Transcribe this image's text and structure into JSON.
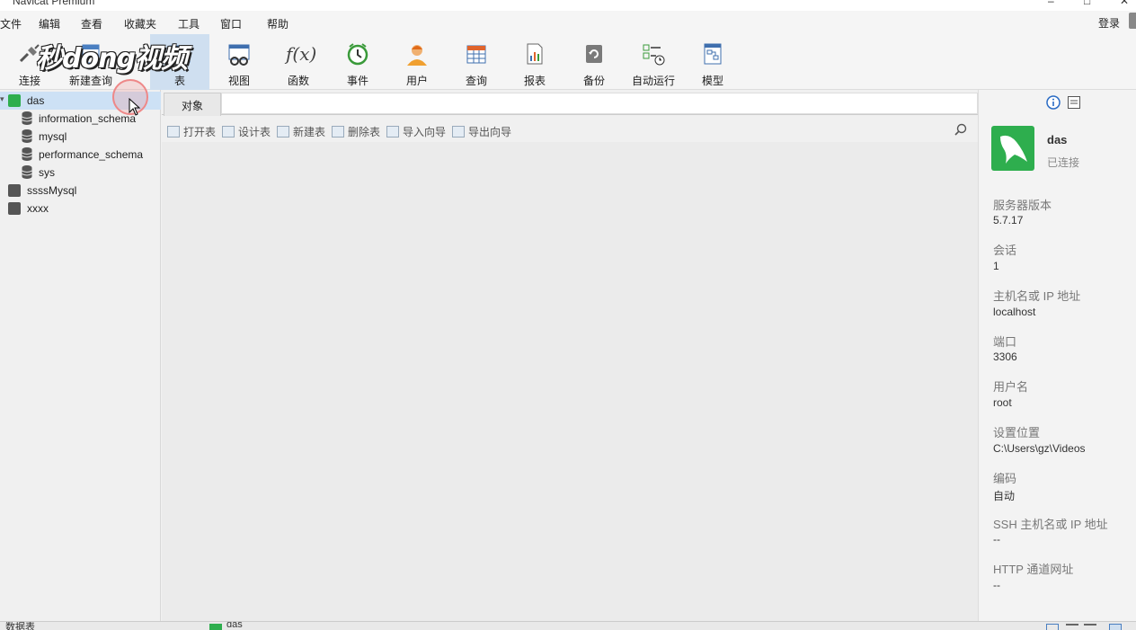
{
  "window": {
    "title": "Navicat Premium",
    "controls": [
      "–",
      "□",
      "✕"
    ]
  },
  "menu": [
    "文件",
    "编辑",
    "查看",
    "收藏夹",
    "工具",
    "窗口",
    "帮助"
  ],
  "login_label": "登录",
  "toolbar": {
    "items": [
      {
        "label": "连接",
        "icon": "connection-icon"
      },
      {
        "label": "新建查询",
        "icon": "new-query-icon"
      },
      {
        "label": "表",
        "icon": "table-icon",
        "active": true
      },
      {
        "label": "视图",
        "icon": "view-icon"
      },
      {
        "label": "函数",
        "icon": "function-icon",
        "glyph": "f(x)"
      },
      {
        "label": "事件",
        "icon": "event-clock-icon"
      },
      {
        "label": "用户",
        "icon": "user-icon"
      },
      {
        "label": "查询",
        "icon": "query-icon"
      },
      {
        "label": "报表",
        "icon": "report-icon"
      },
      {
        "label": "备份",
        "icon": "backup-icon"
      },
      {
        "label": "自动运行",
        "icon": "automation-icon"
      },
      {
        "label": "模型",
        "icon": "model-icon"
      }
    ]
  },
  "watermark": "秒dong视频",
  "tree": {
    "connections": [
      {
        "name": "das",
        "expanded": true,
        "selected": true,
        "databases": [
          "information_schema",
          "mysql",
          "performance_schema",
          "sys"
        ]
      },
      {
        "name": "ssssMysql"
      },
      {
        "name": "xxxx"
      }
    ]
  },
  "tabs": {
    "objects": "对象"
  },
  "object_toolbar": [
    "打开表",
    "设计表",
    "新建表",
    "删除表",
    "导入向导",
    "导出向导"
  ],
  "info_panel": {
    "name": "das",
    "status": "已连接",
    "fields": [
      {
        "label": "服务器版本",
        "value": "5.7.17"
      },
      {
        "label": "会话",
        "value": "1"
      },
      {
        "label": "主机名或 IP 地址",
        "value": "localhost"
      },
      {
        "label": "端口",
        "value": "3306"
      },
      {
        "label": "用户名",
        "value": "root"
      },
      {
        "label": "设置位置",
        "value": "C:\\Users\\gz\\Videos"
      },
      {
        "label": "编码",
        "value": "自动"
      },
      {
        "label": "SSH 主机名或 IP 地址",
        "value": "--"
      },
      {
        "label": "HTTP 通道网址",
        "value": "--"
      }
    ]
  },
  "statusbar": {
    "left": "数据表",
    "connection": "das"
  },
  "colors": {
    "accent": "#cfdff0",
    "mysql_green": "#2eae4e",
    "selection": "#cde1f5"
  }
}
